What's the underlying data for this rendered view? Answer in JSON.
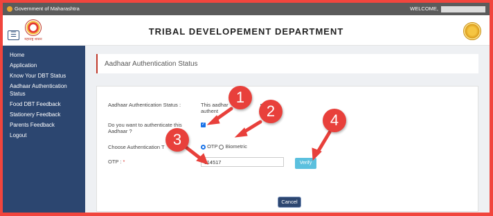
{
  "gov_bar": {
    "left_text": "Government of Maharashtra",
    "right_text": "WELCOME,"
  },
  "header": {
    "title": "TRIBAL DEVELOPEMENT DEPARTMENT",
    "menu_icon": "☰",
    "logo_caption": "महाराष्ट्र शासन"
  },
  "sidebar": {
    "items": [
      {
        "label": "Home"
      },
      {
        "label": "Application"
      },
      {
        "label": "Know Your DBT Status"
      },
      {
        "label": "Aadhaar Authentication Status"
      },
      {
        "label": "Food DBT Feedback"
      },
      {
        "label": "Stationery Feedback"
      },
      {
        "label": "Parents Feedback"
      },
      {
        "label": "Logout"
      }
    ]
  },
  "page": {
    "heading": "Aadhaar Authentication Status"
  },
  "form": {
    "status_label": "Aadhaar Authentication Status :",
    "status_value_line1": "This aadhar",
    "status_value_line1_tail": "s",
    "status_value_line2": "authent",
    "authenticate_label": "Do you want to authenticate this Aadhaar ?",
    "authenticate_checked": true,
    "auth_type_label": "Choose Authentication T",
    "auth_options": [
      "OTP",
      "Biometric"
    ],
    "auth_selected": "OTP",
    "otp_label": "OTP :",
    "otp_required_mark": "*",
    "otp_value": "114517",
    "verify_label": "Verify",
    "cancel_label": "Cancel"
  },
  "annotations": [
    "1",
    "2",
    "3",
    "4"
  ],
  "colors": {
    "sidebar_bg": "#2c4670",
    "annotation_red": "#e8403b",
    "verify_bg": "#5bc0de",
    "gov_bar_bg": "#5b5b5b"
  }
}
